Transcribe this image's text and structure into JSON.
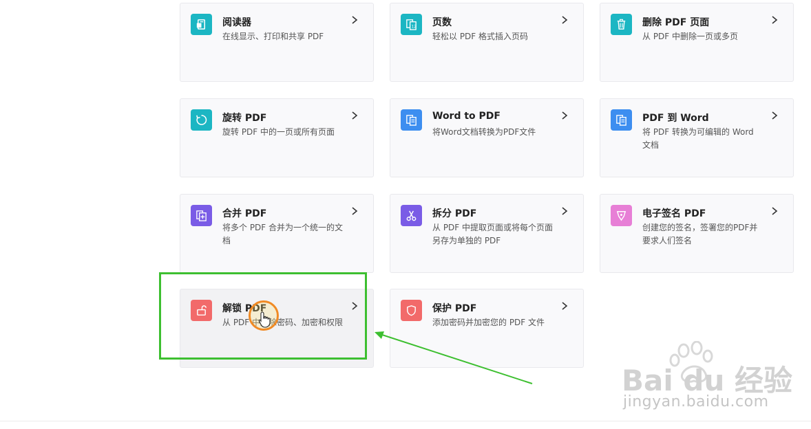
{
  "cards": [
    {
      "id": "reader",
      "title": "阅读器",
      "desc": "在线显示、打印和共享 PDF",
      "icon": "reader-icon",
      "color": "#1cb6c3"
    },
    {
      "id": "page-numbers",
      "title": "页数",
      "desc": "轻松以 PDF 格式插入页码",
      "icon": "page-numbers-icon",
      "color": "#1cb6c3"
    },
    {
      "id": "delete-pages",
      "title": "删除 PDF 页面",
      "desc": "从 PDF 中删除一页或多页",
      "icon": "trash-icon",
      "color": "#1cb6c3"
    },
    {
      "id": "rotate",
      "title": "旋转 PDF",
      "desc": "旋转 PDF 中的一页或所有页面",
      "icon": "rotate-icon",
      "color": "#1cb6c3"
    },
    {
      "id": "word-to-pdf",
      "title": "Word to PDF",
      "desc": "将Word文档转换为PDF文件",
      "icon": "word-to-pdf-icon",
      "color": "#3d8ef0"
    },
    {
      "id": "pdf-to-word",
      "title": "PDF 到 Word",
      "desc": "将 PDF 转换为可编辑的 Word 文档",
      "icon": "pdf-to-word-icon",
      "color": "#3d8ef0"
    },
    {
      "id": "merge",
      "title": "合并 PDF",
      "desc": "将多个 PDF 合并为一个统一的文档",
      "icon": "merge-icon",
      "color": "#7a5ce6"
    },
    {
      "id": "split",
      "title": "拆分 PDF",
      "desc": "从 PDF 中提取页面或将每个页面另存为单独的 PDF",
      "icon": "scissors-icon",
      "color": "#7a5ce6"
    },
    {
      "id": "esign",
      "title": "电子签名 PDF",
      "desc": "创建您的签名，签署您的PDF并要求人们签名",
      "icon": "pen-nib-icon",
      "color": "#e77fd6"
    },
    {
      "id": "unlock",
      "title": "解锁 PDF",
      "desc": "从 PDF 中删除密码、加密和权限",
      "icon": "unlock-icon",
      "color": "#f26a6a"
    },
    {
      "id": "protect",
      "title": "保护 PDF",
      "desc": "添加密码并加密您的 PDF 文件",
      "icon": "shield-icon",
      "color": "#f26a6a"
    }
  ],
  "highlighted_card": "unlock",
  "annotation_color": "#3dbf30",
  "watermark": {
    "brand": "Bai du 经验",
    "url": "jingyan.baidu.com"
  }
}
